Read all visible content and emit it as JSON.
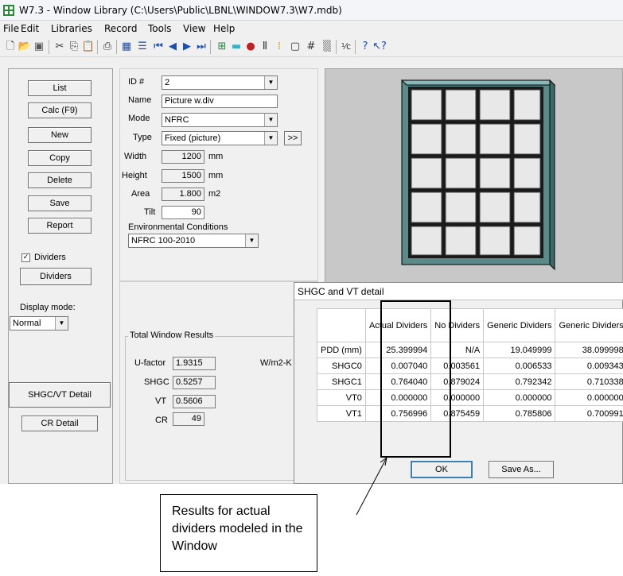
{
  "window": {
    "title": "W7.3 - Window Library (C:\\Users\\Public\\LBNL\\WINDOW7.3\\W7.mdb)"
  },
  "menu": [
    "File",
    "Edit",
    "Libraries",
    "Record",
    "Tools",
    "View",
    "Help"
  ],
  "toolbar_icons": [
    "new-icon",
    "open-icon",
    "save-icon",
    "cut-icon",
    "copy-icon",
    "paste-icon",
    "print-icon",
    "list-icon",
    "detail-icon",
    "first-record-icon",
    "prev-record-icon",
    "next-record-icon",
    "last-record-icon",
    "window-icon",
    "glazing-icon",
    "gas-icon",
    "frame-icon",
    "divider-icon",
    "shading-icon",
    "grid-icon",
    "pattern-icon",
    "fraction-icon",
    "help-icon",
    "context-help-icon"
  ],
  "left_buttons": {
    "list": "List",
    "calc": "Calc (F9)",
    "new": "New",
    "copy": "Copy",
    "delete": "Delete",
    "save": "Save",
    "report": "Report",
    "dividers_checkbox": "Dividers",
    "dividers_button": "Dividers",
    "display_mode_label": "Display mode:",
    "display_mode_value": "Normal",
    "shgc_detail": "SHGC/VT Detail",
    "cr_detail": "CR Detail"
  },
  "form": {
    "id_label": "ID #",
    "id_value": "2",
    "name_label": "Name",
    "name_value": "Picture w.div",
    "mode_label": "Mode",
    "mode_value": "NFRC",
    "type_label": "Type",
    "type_value": "Fixed (picture)",
    "type_more": ">>",
    "width_label": "Width",
    "width_value": "1200",
    "width_unit": "mm",
    "height_label": "Height",
    "height_value": "1500",
    "height_unit": "mm",
    "area_label": "Area",
    "area_value": "1.800",
    "area_unit": "m2",
    "tilt_label": "Tilt",
    "tilt_value": "90",
    "env_label": "Environmental Conditions",
    "env_value": "NFRC 100-2010"
  },
  "results": {
    "group_label": "Total Window Results",
    "ufactor_label": "U-factor",
    "ufactor_value": "1.9315",
    "ufactor_unit": "W/m2-K",
    "shgc_label": "SHGC",
    "shgc_value": "0.5257",
    "vt_label": "VT",
    "vt_value": "0.5606",
    "cr_label": "CR",
    "cr_value": "49"
  },
  "dialog": {
    "title": "SHGC and VT detail",
    "columns": [
      "Actual Dividers",
      "No Dividers",
      "Generic Dividers",
      "Generic Dividers"
    ],
    "rows": [
      {
        "label": "PDD (mm)",
        "values": [
          "25.399994",
          "N/A",
          "19.049999",
          "38.099998"
        ]
      },
      {
        "label": "SHGC0",
        "values": [
          "0.007040",
          "0.003561",
          "0.006533",
          "0.009343"
        ]
      },
      {
        "label": "SHGC1",
        "values": [
          "0.764040",
          "0.879024",
          "0.792342",
          "0.710338"
        ]
      },
      {
        "label": "VT0",
        "values": [
          "0.000000",
          "0.000000",
          "0.000000",
          "0.000000"
        ]
      },
      {
        "label": "VT1",
        "values": [
          "0.756996",
          "0.875459",
          "0.785806",
          "0.700991"
        ]
      }
    ],
    "ok": "OK",
    "save_as": "Save As..."
  },
  "callout": {
    "text": "Results for actual dividers modeled in the Window"
  }
}
